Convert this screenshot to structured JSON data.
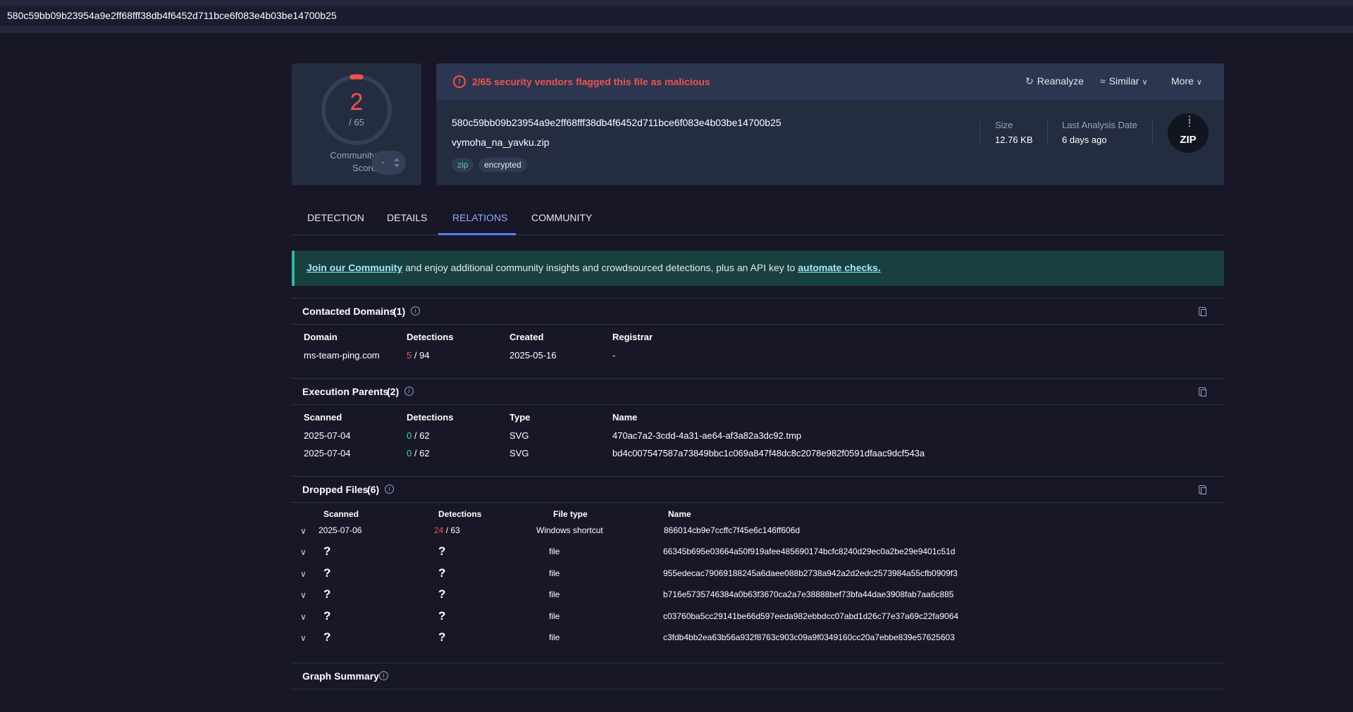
{
  "search": {
    "value": "580c59bb09b23954a9e2ff68fff38db4f6452d711bce6f083e4b03be14700b25"
  },
  "score": {
    "detected": "2",
    "total": "/ 65",
    "community_label_1": "Community",
    "community_label_2": "Score",
    "vote_value": "-"
  },
  "header": {
    "alert": "2/65 security vendors flagged this file as malicious",
    "actions": {
      "reanalyze": "Reanalyze",
      "similar": "Similar",
      "more": "More"
    },
    "hash": "580c59bb09b23954a9e2ff68fff38db4f6452d711bce6f083e4b03be14700b25",
    "filename": "vymoha_na_yavku.zip",
    "tags": [
      "zip",
      "encrypted"
    ],
    "size_label": "Size",
    "size_value": "12.76 KB",
    "date_label": "Last Analysis Date",
    "date_value": "6 days ago",
    "type_badge": "ZIP"
  },
  "tabs": [
    "DETECTION",
    "DETAILS",
    "RELATIONS",
    "COMMUNITY"
  ],
  "active_tab": "RELATIONS",
  "banner": {
    "link1": "Join our Community",
    "middle": " and enjoy additional community insights and crowdsourced detections, plus an API key to ",
    "link2": "automate checks."
  },
  "contacted_domains": {
    "title": "Contacted Domains",
    "count": "(1)",
    "columns": [
      "Domain",
      "Detections",
      "Created",
      "Registrar"
    ],
    "rows": [
      {
        "domain": "ms-team-ping.com",
        "det": "5",
        "det_total": "/ 94",
        "created": "2025-05-16",
        "registrar": "-"
      }
    ]
  },
  "execution_parents": {
    "title": "Execution Parents",
    "count": "(2)",
    "columns": [
      "Scanned",
      "Detections",
      "Type",
      "Name"
    ],
    "rows": [
      {
        "scanned": "2025-07-04",
        "det": "0",
        "det_total": "/ 62",
        "type": "SVG",
        "name": "470ac7a2-3cdd-4a31-ae64-af3a82a3dc92.tmp"
      },
      {
        "scanned": "2025-07-04",
        "det": "0",
        "det_total": "/ 62",
        "type": "SVG",
        "name": "bd4c007547587a73849bbc1c069a847f48dc8c2078e982f0591dfaac9dcf543a"
      }
    ]
  },
  "dropped_files": {
    "title": "Dropped Files",
    "count": "(6)",
    "columns": [
      "Scanned",
      "Detections",
      "File type",
      "Name"
    ],
    "rows": [
      {
        "scanned": "2025-07-06",
        "det": "24",
        "det_total": "/ 63",
        "type": "Windows shortcut",
        "name": "866014cb9e7ccffc7f45e6c146ff606d"
      },
      {
        "scanned": "?",
        "det": "?",
        "det_total": "",
        "type": "file",
        "name": "66345b695e03664a50f919afee485690174bcfc8240d29ec0a2be29e9401c51d"
      },
      {
        "scanned": "?",
        "det": "?",
        "det_total": "",
        "type": "file",
        "name": "955edecac79069188245a6daee088b2738a942a2d2edc2573984a55cfb0909f3"
      },
      {
        "scanned": "?",
        "det": "?",
        "det_total": "",
        "type": "file",
        "name": "b716e5735746384a0b63f3670ca2a7e38888bef73bfa44dae3908fab7aa6c885"
      },
      {
        "scanned": "?",
        "det": "?",
        "det_total": "",
        "type": "file",
        "name": "c03760ba5cc29141be66d597eeda982ebbdcc07abd1d26c77e37a69c22fa9064"
      },
      {
        "scanned": "?",
        "det": "?",
        "det_total": "",
        "type": "file",
        "name": "c3fdb4bb2ea63b56a932f8763c903c09a9f0349160cc20a7ebbe839e57625603"
      }
    ]
  },
  "graph_summary": {
    "title": "Graph Summary"
  },
  "colors": {
    "malicious": "#ef5350",
    "clean": "#4dd0a8",
    "accent": "#5b7cff",
    "background": "#171728",
    "card": "#242c40"
  },
  "icons": [
    "reanalyze-icon",
    "similar-icon",
    "chevron-down-icon",
    "alert-icon",
    "info-icon",
    "copy-icon",
    "zip-file-icon"
  ]
}
